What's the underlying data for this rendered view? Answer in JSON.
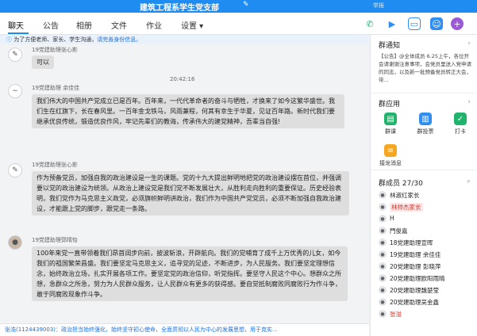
{
  "window": {
    "title": "建筑工程系学生党支部",
    "extra": "举报"
  },
  "tabs": [
    {
      "label": "聊天",
      "active": true
    },
    {
      "label": "公告"
    },
    {
      "label": "相册"
    },
    {
      "label": "文件"
    },
    {
      "label": "作业"
    },
    {
      "label": "设置 ▾"
    }
  ],
  "toolbar_icons": [
    "phone-icon",
    "video-icon",
    "screen-share-icon",
    "group-icon",
    "add-icon"
  ],
  "notice_bar": {
    "text": "为了方便老师、家长、学生沟通，",
    "link": "请完善身份信息。"
  },
  "messages": [
    {
      "sender": "19党建助理张心影",
      "text": "可以"
    },
    {
      "timestamp": "20:42:16"
    },
    {
      "sender": "19党建助理 余佳佳",
      "text": "我们伟大的中国共产党成立已是百年。百年来，一代代革命者的奋斗与牺牲，才换来了如今这繁华盛世。我们生在红旗下，长在春风里。一百年金戈铁马，风雨兼程，何其有幸生于华夏，见证百年路。新时代我们要继承优良传统，锻造优良作风，牢记先辈们的教诲，传承伟大的建党精神，吾辈当自强!"
    },
    {
      "sender": "19党建助理张心影",
      "text": "作为预备党员，加强自我的政治建设是一生的课题。党的十九大提出鲜明地把党的政治建设摆在首位，并强调要以党的政治建设为统领。从政治上建设党是我们党不断发展壮大，从胜利走向胜利的重要保证。历史经验表明，我们党作为马克思主义政党，必须旗帜鲜明讲政治，我们作为中国共产党党员，必须不断加强自我政治建设，才能跟上党的脚步，跟党走一条路。"
    },
    {
      "sender": "19党建助理郭晴怡",
      "text": "100年来党一直带领着我们昂首阔步向前，披波斩浪，开辟航向。我们的党哺育了成千上万优秀的儿女，如今我们的祖国繁荣昌盛。我们要坚定马克思主义，追寻党的足迹，不断进步，为人民服务。我们要坚定理想信念，始终政治立场，扎实开展各项工作。要坚定党的政治信仰，听党指挥。要坚守人民这个中心。想群众之所想，急群众之所急，努力为人民群众服务，让人民群众有更多的获得感。要自觉抵制腐败同腐败行为作斗争，敢于同腐败现象作斗争。"
    }
  ],
  "bottom_bar": {
    "text": "张浩(1124439003)：政治担当始终强化，始终坚守初心使命，全面贯彻以人民为中心的发展思想，用于克实..."
  },
  "right_panel": {
    "notice": {
      "title": "群通知",
      "text": "【公告】@全体成员 6.25上午，各位开会请谢谢注意事项，会党员里送入党申请的同志，以及新一批预备党员转正大会，带..."
    },
    "apps": {
      "title": "群应用",
      "items": [
        {
          "label": "群课",
          "icon": "class-icon",
          "color": "#21b36b"
        },
        {
          "label": "群投票",
          "icon": "vote-icon",
          "color": "#2f8ef0"
        },
        {
          "label": "打卡",
          "icon": "checkin-icon",
          "color": "#21b36b"
        },
        {
          "label": "接龙消息",
          "icon": "relay-icon",
          "color": "#f5a623"
        }
      ]
    },
    "members": {
      "title": "群成员",
      "count": "27/30",
      "list": [
        {
          "name": "林淑红家长",
          "style": "normal"
        },
        {
          "name": "林帅杰家长",
          "style": "lead"
        },
        {
          "name": "H",
          "style": "normal"
        },
        {
          "name": "門俊嘉",
          "style": "normal"
        },
        {
          "name": "18党建助理宣晖",
          "style": "normal"
        },
        {
          "name": "19党建助理 余佳佳",
          "style": "normal"
        },
        {
          "name": "20党建助理 彭晓萍",
          "style": "normal"
        },
        {
          "name": "20党建助理欧阳雨晴",
          "style": "normal"
        },
        {
          "name": "20党建助理魏楚莹",
          "style": "normal"
        },
        {
          "name": "20党建助理吴金鑫",
          "style": "normal"
        },
        {
          "name": "张溢",
          "style": "red"
        }
      ]
    }
  }
}
